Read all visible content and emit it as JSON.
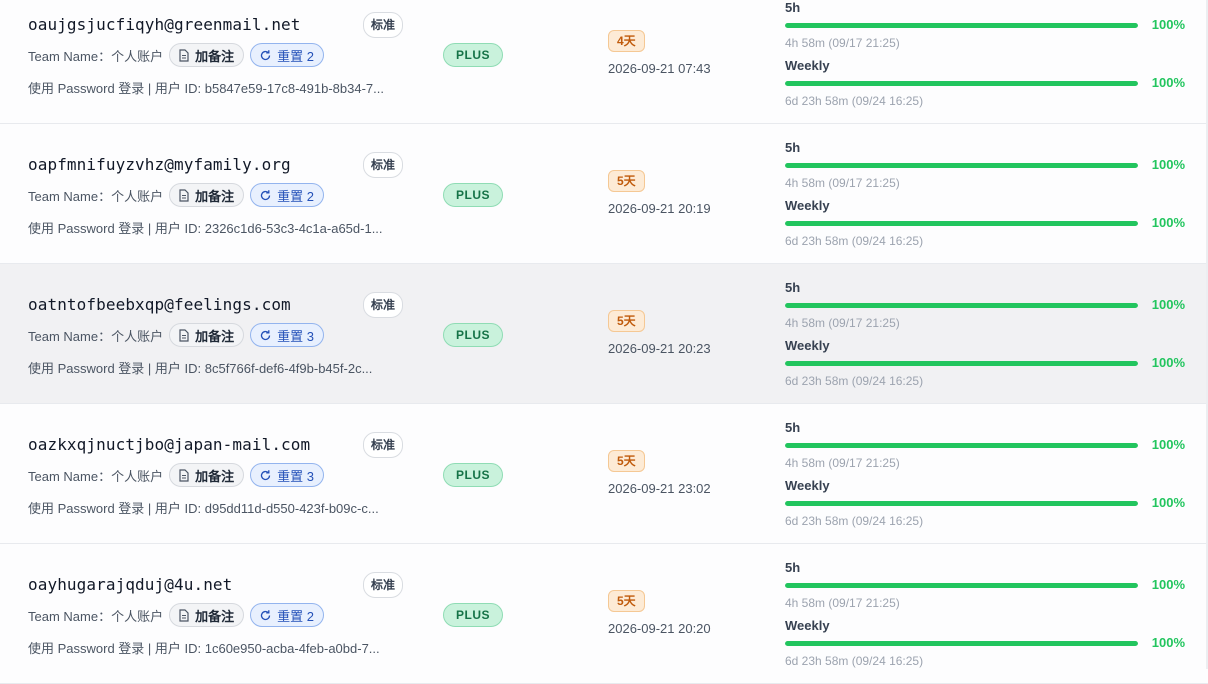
{
  "accounts": [
    {
      "email": "oaujgsjucfiqyh@greenmail.net",
      "tier_badge": "标准",
      "team_label": "Team Name：",
      "team_value": "个人账户",
      "note_label": "加备注",
      "reset_label": "重置 2",
      "login_info": "使用 Password 登录 | 用户 ID: b5847e59-17c8-491b-8b34-7...",
      "plan": "PLUS",
      "days_left": "4天",
      "date": "2026-09-21 07:43",
      "quota": [
        {
          "label": "5h",
          "percent": "100%",
          "fill": 1.0,
          "reset": "4h 58m (09/17 21:25)"
        },
        {
          "label": "Weekly",
          "percent": "100%",
          "fill": 1.0,
          "reset": "6d 23h 58m (09/24 16:25)"
        }
      ]
    },
    {
      "email": "oapfmnifuyzvhz@myfamily.org",
      "tier_badge": "标准",
      "team_label": "Team Name：",
      "team_value": "个人账户",
      "note_label": "加备注",
      "reset_label": "重置 2",
      "login_info": "使用 Password 登录 | 用户 ID: 2326c1d6-53c3-4c1a-a65d-1...",
      "plan": "PLUS",
      "days_left": "5天",
      "date": "2026-09-21 20:19",
      "quota": [
        {
          "label": "5h",
          "percent": "100%",
          "fill": 1.0,
          "reset": "4h 58m (09/17 21:25)"
        },
        {
          "label": "Weekly",
          "percent": "100%",
          "fill": 1.0,
          "reset": "6d 23h 58m (09/24 16:25)"
        }
      ]
    },
    {
      "email": "oatntofbeebxqp@feelings.com",
      "tier_badge": "标准",
      "team_label": "Team Name：",
      "team_value": "个人账户",
      "note_label": "加备注",
      "reset_label": "重置 3",
      "login_info": "使用 Password 登录 | 用户 ID: 8c5f766f-def6-4f9b-b45f-2c...",
      "plan": "PLUS",
      "days_left": "5天",
      "date": "2026-09-21 20:23",
      "quota": [
        {
          "label": "5h",
          "percent": "100%",
          "fill": 1.0,
          "reset": "4h 58m (09/17 21:25)"
        },
        {
          "label": "Weekly",
          "percent": "100%",
          "fill": 1.0,
          "reset": "6d 23h 58m (09/24 16:25)"
        }
      ]
    },
    {
      "email": "oazkxqjnuctjbo@japan-mail.com",
      "tier_badge": "标准",
      "team_label": "Team Name：",
      "team_value": "个人账户",
      "note_label": "加备注",
      "reset_label": "重置 3",
      "login_info": "使用 Password 登录 | 用户 ID: d95dd11d-d550-423f-b09c-c...",
      "plan": "PLUS",
      "days_left": "5天",
      "date": "2026-09-21 23:02",
      "quota": [
        {
          "label": "5h",
          "percent": "100%",
          "fill": 1.0,
          "reset": "4h 58m (09/17 21:25)"
        },
        {
          "label": "Weekly",
          "percent": "100%",
          "fill": 1.0,
          "reset": "6d 23h 58m (09/24 16:25)"
        }
      ]
    },
    {
      "email": "oayhugarajqduj@4u.net",
      "tier_badge": "标准",
      "team_label": "Team Name：",
      "team_value": "个人账户",
      "note_label": "加备注",
      "reset_label": "重置 2",
      "login_info": "使用 Password 登录 | 用户 ID: 1c60e950-acba-4feb-a0bd-7...",
      "plan": "PLUS",
      "days_left": "5天",
      "date": "2026-09-21 20:20",
      "quota": [
        {
          "label": "5h",
          "percent": "100%",
          "fill": 1.0,
          "reset": "4h 58m (09/17 21:25)"
        },
        {
          "label": "Weekly",
          "percent": "100%",
          "fill": 1.0,
          "reset": "6d 23h 58m (09/24 16:25)"
        }
      ]
    }
  ],
  "colors": {
    "accent_green": "#22c55e",
    "reset_blue": "#2350b8",
    "days_orange": "#c05a0b",
    "plan_green": "#157347",
    "row_highlight": "#f1f1f3"
  },
  "icons": {
    "note": "document-icon",
    "reset": "refresh-icon"
  }
}
